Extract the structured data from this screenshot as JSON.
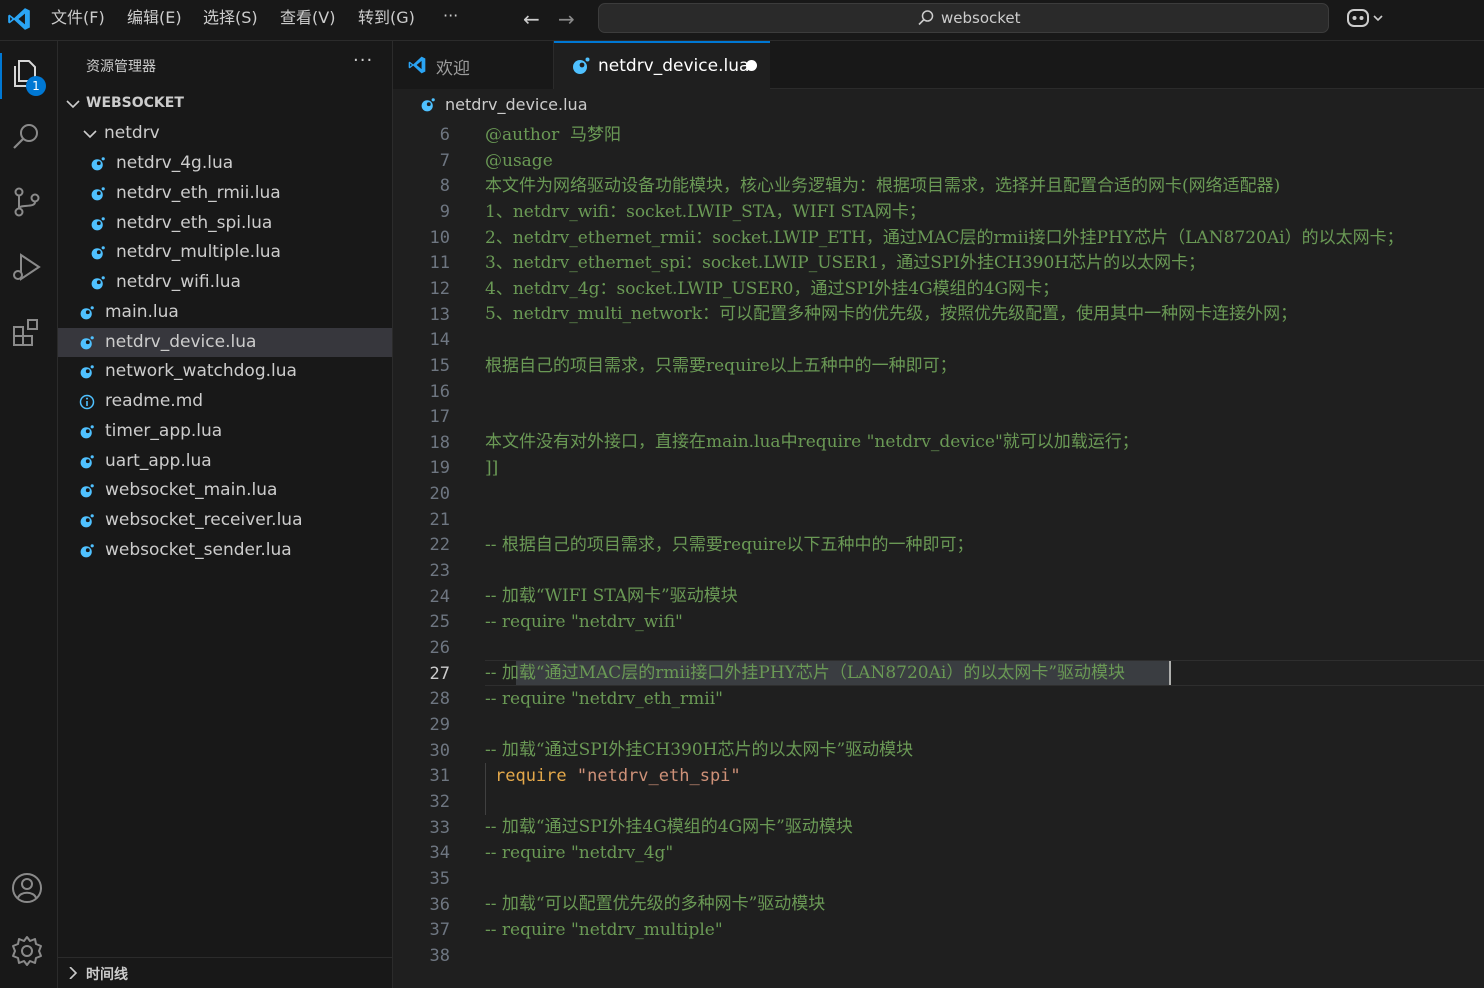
{
  "titlebar": {
    "menus": [
      "文件(F)",
      "编辑(E)",
      "选择(S)",
      "查看(V)",
      "转到(G)",
      "···"
    ],
    "command_center_text": "websocket"
  },
  "activitybar": {
    "explorer_badge": "1"
  },
  "sidebar": {
    "title": "资源管理器",
    "more": "···",
    "root_folder": "WEBSOCKET",
    "subfolder": "netdrv",
    "subfolder_files": [
      "netdrv_4g.lua",
      "netdrv_eth_rmii.lua",
      "netdrv_eth_spi.lua",
      "netdrv_multiple.lua",
      "netdrv_wifi.lua"
    ],
    "root_files": [
      "main.lua",
      "netdrv_device.lua",
      "network_watchdog.lua",
      "readme.md",
      "timer_app.lua",
      "uart_app.lua",
      "websocket_main.lua",
      "websocket_receiver.lua",
      "websocket_sender.lua"
    ],
    "timeline": "时间线"
  },
  "tabs": {
    "welcome": "欢迎",
    "active": "netdrv_device.lua"
  },
  "breadcrumb": "netdrv_device.lua",
  "editor": {
    "line_numbers": [
      "6",
      "7",
      "8",
      "9",
      "10",
      "11",
      "12",
      "13",
      "14",
      "15",
      "16",
      "17",
      "18",
      "19",
      "20",
      "21",
      "22",
      "23",
      "24",
      "25",
      "26",
      "27",
      "28",
      "29",
      "30",
      "31",
      "32",
      "33",
      "34",
      "35",
      "36",
      "37",
      "38"
    ],
    "active_line": "27",
    "lines": {
      "l6": "@author  马梦阳",
      "l7": "@usage",
      "l8": "本文件为网络驱动设备功能模块，核心业务逻辑为：根据项目需求，选择并且配置合适的网卡(网络适配器)",
      "l9": "1、netdrv_wifi：socket.LWIP_STA，WIFI STA网卡；",
      "l10": "2、netdrv_ethernet_rmii：socket.LWIP_ETH，通过MAC层的rmii接口外挂PHY芯片（LAN8720Ai）的以太网卡；",
      "l11": "3、netdrv_ethernet_spi：socket.LWIP_USER1，通过SPI外挂CH390H芯片的以太网卡；",
      "l12": "4、netdrv_4g：socket.LWIP_USER0，通过SPI外挂4G模组的4G网卡；",
      "l13": "5、netdrv_multi_network：可以配置多种网卡的优先级，按照优先级配置，使用其中一种网卡连接外网；",
      "l15": "根据自己的项目需求，只需要require以上五种中的一种即可；",
      "l18": "本文件没有对外接口，直接在main.lua中require \"netdrv_device\"就可以加载运行；",
      "l19": "]]",
      "l22": "-- 根据自己的项目需求，只需要require以下五种中的一种即可；",
      "l24": "-- 加载“WIFI STA网卡”驱动模块",
      "l25": "-- require \"netdrv_wifi\"",
      "l27_prefix": "-- ",
      "l27_selected": "加载“通过MAC层的rmii接口外挂PHY芯片（LAN8720Ai）的以太网卡”驱动模块",
      "l28": "-- require \"netdrv_eth_rmii\"",
      "l30": "-- 加载“通过SPI外挂CH390H芯片的以太网卡”驱动模块",
      "l31_kw": "require",
      "l31_str": " \"netdrv_eth_spi\"",
      "l33": "-- 加载“通过SPI外挂4G模组的4G网卡”驱动模块",
      "l34": "-- require \"netdrv_4g\"",
      "l36": "-- 加载“可以配置优先级的多种网卡”驱动模块",
      "l37": "-- require \"netdrv_multiple\""
    }
  },
  "colors": {
    "accent": "#0078d4",
    "comment": "#6a9955",
    "string": "#ce9178",
    "lua_icon": "#4fc1ff"
  }
}
